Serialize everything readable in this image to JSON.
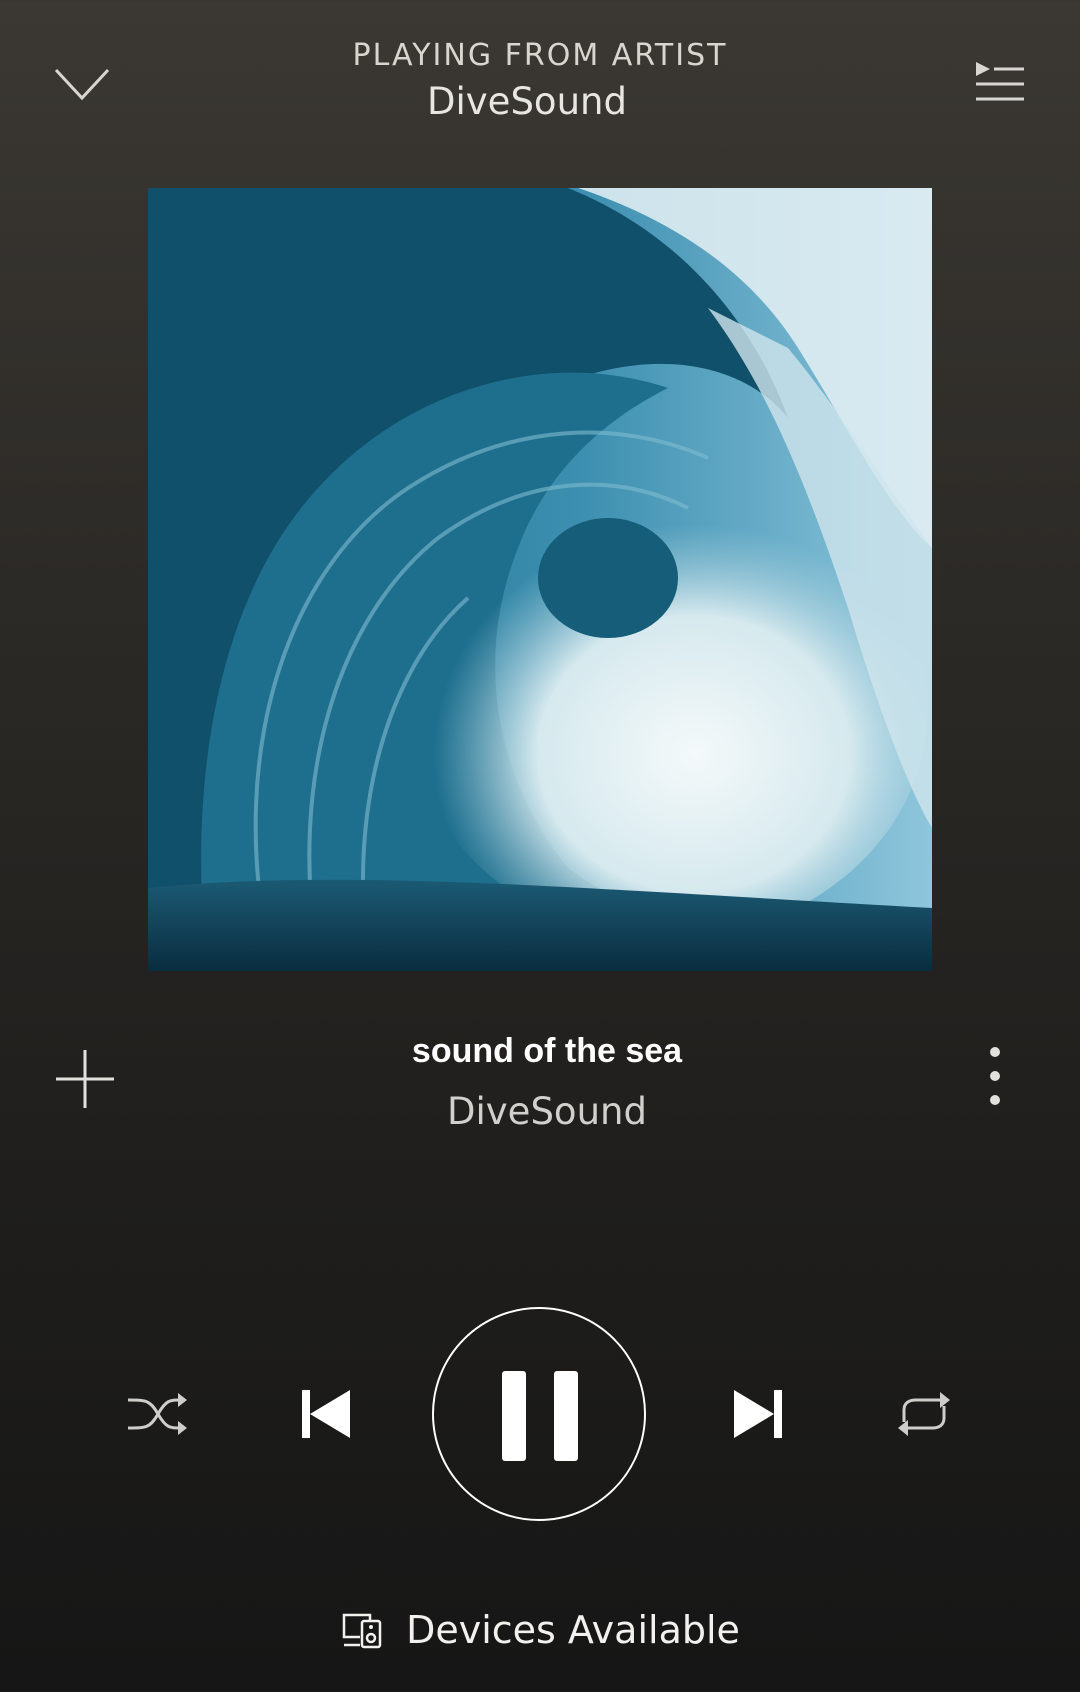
{
  "header": {
    "context_label": "PLAYING FROM ARTIST",
    "context_name": "DiveSound",
    "collapse_icon": "chevron-down-icon",
    "queue_icon": "queue-icon"
  },
  "artwork": {
    "subject": "ocean wave",
    "colors": {
      "deep": "#0f4a63",
      "mid": "#2b7e9b",
      "foam": "#e8f2f4",
      "sky": "#6fb4cf"
    }
  },
  "track": {
    "title": "sound of the sea",
    "artist": "DiveSound",
    "add_icon": "plus-icon",
    "more_icon": "more-vertical-icon"
  },
  "controls": {
    "shuffle_icon": "shuffle-icon",
    "previous_icon": "skip-previous-icon",
    "state": "playing",
    "play_pause_icon": "pause-icon",
    "next_icon": "skip-next-icon",
    "repeat_icon": "repeat-icon"
  },
  "devices": {
    "label": "Devices Available",
    "icon": "devices-icon"
  },
  "theme": {
    "background_top": "#3b3833",
    "background_bottom": "#161616",
    "text_primary": "#ffffff",
    "text_secondary": "#d2d0cc"
  }
}
